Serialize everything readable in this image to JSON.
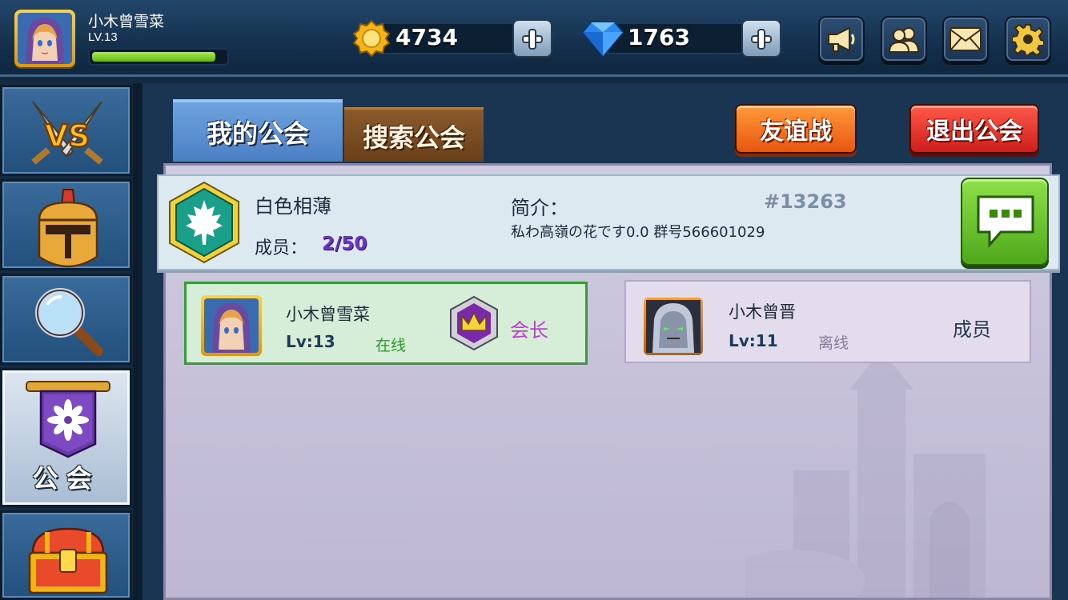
{
  "player": {
    "name": "小木曾雪菜",
    "level": "LV.13",
    "xp_progress": 0.93
  },
  "currencies": {
    "gold": "4734",
    "gems": "1763"
  },
  "top_icons": [
    "megaphone-icon",
    "friends-icon",
    "mail-icon",
    "settings-icon"
  ],
  "sidebar": {
    "items": [
      {
        "name": "pvp",
        "icon": "vs-swords-icon",
        "label": ""
      },
      {
        "name": "heroes",
        "icon": "knight-helmet-icon",
        "label": ""
      },
      {
        "name": "search",
        "icon": "magnifier-icon",
        "label": ""
      },
      {
        "name": "guild",
        "icon": "guild-banner-icon",
        "label": "公会"
      },
      {
        "name": "chest",
        "icon": "treasure-chest-icon",
        "label": ""
      }
    ],
    "active": "guild"
  },
  "tabs": {
    "my_guild": "我的公会",
    "search_guild": "搜索公会"
  },
  "buttons": {
    "friendly_battle": "友谊战",
    "leave_guild": "退出公会"
  },
  "guild": {
    "name": "白色相薄",
    "members_label": "成员：",
    "members_value": "2/50",
    "intro_label": "简介：",
    "id": "#13263",
    "intro_text": "私わ高嶺の花です0.0 群号566601029"
  },
  "members": [
    {
      "name": "小木曾雪菜",
      "level": "Lv:13",
      "status": "在线",
      "role": "会长"
    },
    {
      "name": "小木曾晋",
      "level": "Lv:11",
      "status": "离线",
      "role": "成员"
    }
  ],
  "colors": {
    "online": "#2a9a2a",
    "offline": "#8a7a9a",
    "leader_role": "#c43ad4",
    "members_count": "#6a36c8"
  }
}
